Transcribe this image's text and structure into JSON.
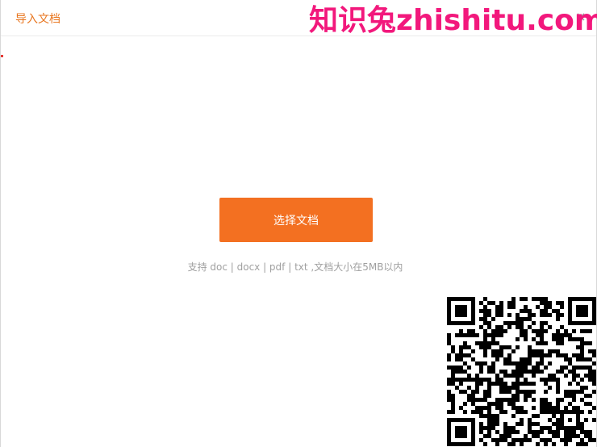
{
  "window": {
    "title": "导入文档",
    "close_glyph": "×"
  },
  "watermark": {
    "text": "知识兔zhishitu.com"
  },
  "upload": {
    "button_label": "选择文档",
    "hint": "支持 doc | docx | pdf | txt ,文档大小在5MB以内"
  },
  "icons": {
    "close": "close-icon",
    "qr": "qr-code-icon"
  },
  "colors": {
    "accent": "#f37021",
    "title": "#e8761f",
    "watermark": "#f2187c"
  }
}
